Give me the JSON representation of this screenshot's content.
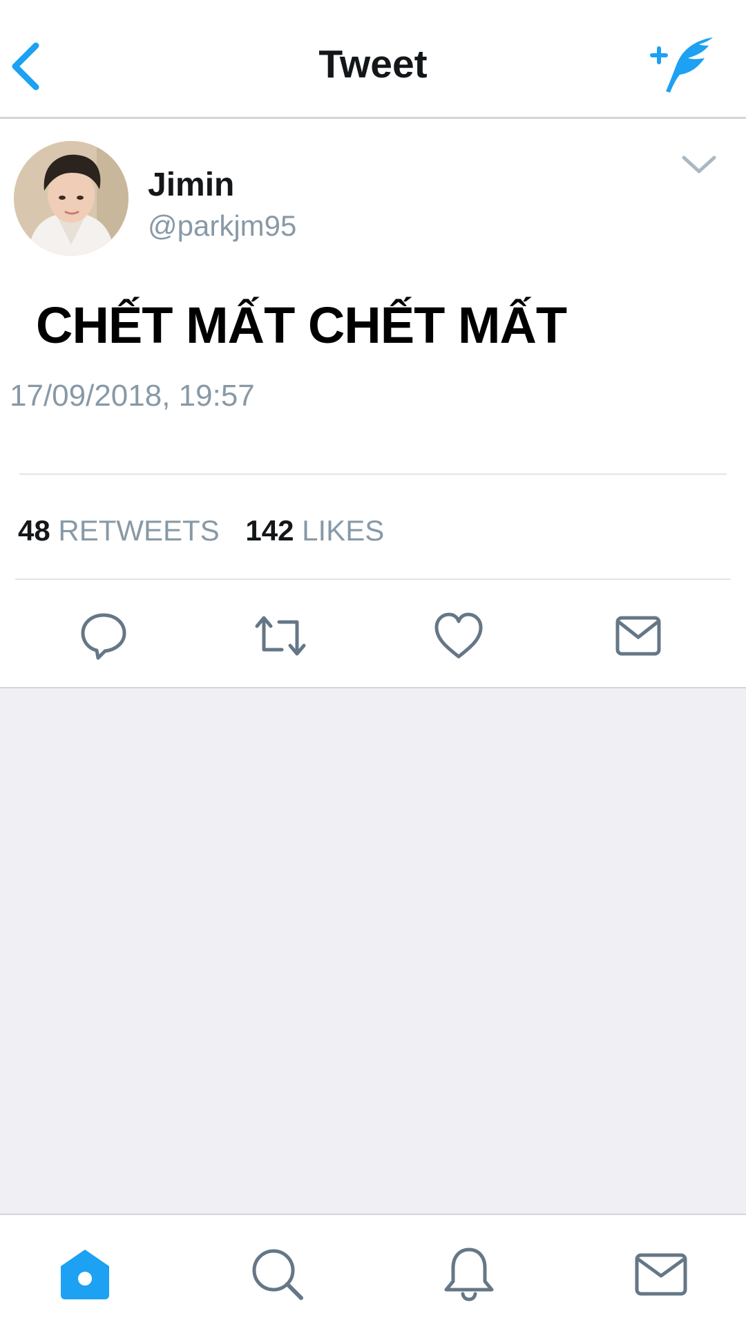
{
  "header": {
    "title": "Tweet",
    "back_icon": "chevron-left-icon",
    "compose_icon": "compose-tweet-icon"
  },
  "tweet": {
    "author_name": "Jimin",
    "author_handle": "@parkjm95",
    "text": "CHẾT MẤT CHẾT MẤT",
    "timestamp": "17/09/2018, 19:57",
    "retweet_count": "48",
    "retweet_label": "RETWEETS",
    "like_count": "142",
    "like_label": "LIKES"
  },
  "actions": [
    "reply-icon",
    "retweet-icon",
    "like-icon",
    "direct-message-icon"
  ],
  "tabbar": {
    "tabs": [
      "home-icon",
      "search-icon",
      "notifications-icon",
      "messages-icon"
    ],
    "active": "home-icon"
  },
  "colors": {
    "accent": "#1da1f2",
    "text": "#14171a",
    "secondary_text": "#8899a6",
    "background_gray": "#efeff4"
  }
}
